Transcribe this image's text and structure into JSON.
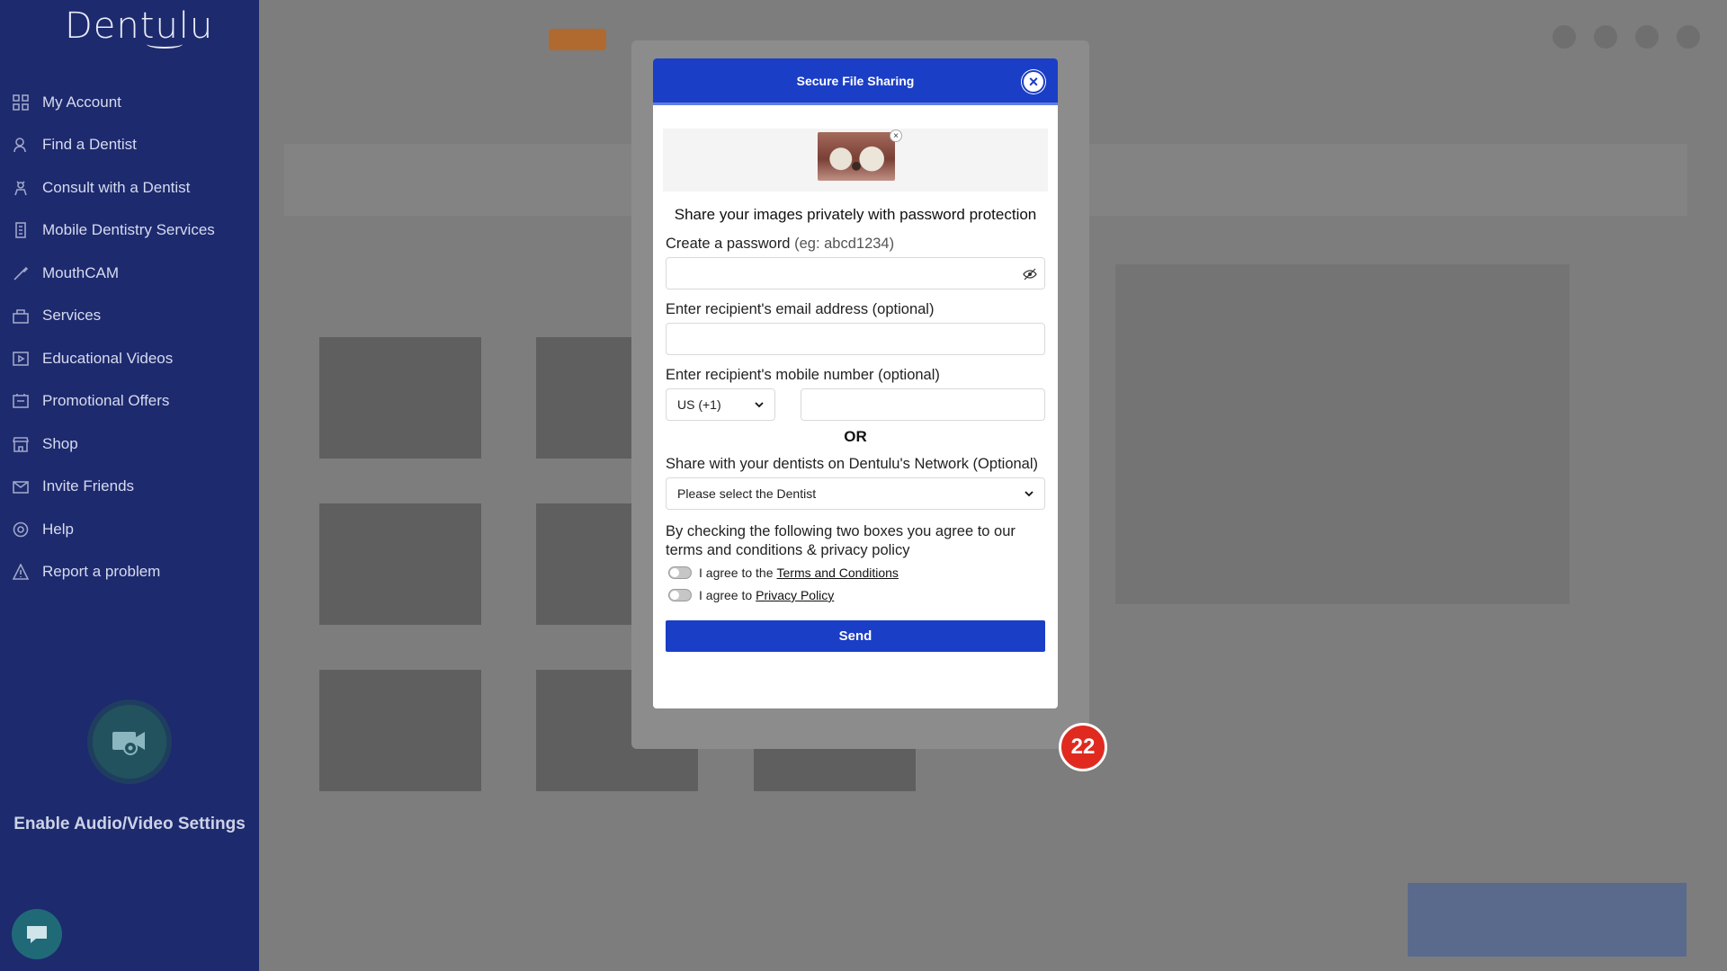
{
  "sidebar": {
    "logo": "Dentulu",
    "items": [
      {
        "label": "My Account",
        "icon": "grid-icon"
      },
      {
        "label": "Find a Dentist",
        "icon": "user-search-icon"
      },
      {
        "label": "Consult with a Dentist",
        "icon": "consult-icon"
      },
      {
        "label": "Mobile Dentistry Services",
        "icon": "building-icon"
      },
      {
        "label": "MouthCAM",
        "icon": "camera-wand-icon"
      },
      {
        "label": "Services",
        "icon": "services-icon"
      },
      {
        "label": "Educational Videos",
        "icon": "video-icon"
      },
      {
        "label": "Promotional Offers",
        "icon": "tag-icon"
      },
      {
        "label": "Shop",
        "icon": "shop-icon"
      },
      {
        "label": "Invite Friends",
        "icon": "invite-icon"
      },
      {
        "label": "Help",
        "icon": "help-icon"
      },
      {
        "label": "Report a problem",
        "icon": "warning-icon"
      }
    ],
    "av_settings_label": "Enable Audio/Video Settings"
  },
  "modal": {
    "title": "Secure File Sharing",
    "share_heading": "Share your images privately with password protection",
    "password_label": "Create a password",
    "password_hint": "(eg: abcd1234)",
    "email_label": "Enter recipient's email address (optional)",
    "mobile_label": "Enter recipient's mobile number (optional)",
    "country_code": "US (+1)",
    "or_text": "OR",
    "network_label": "Share with your dentists on Dentulu's Network (Optional)",
    "dentist_placeholder": "Please select the Dentist",
    "agreement_text": "By checking the following two boxes you agree to our terms and conditions & privacy policy",
    "terms_prefix": "I agree to the",
    "terms_link": "Terms and Conditions",
    "privacy_prefix": "I agree to",
    "privacy_link": "Privacy Policy",
    "send_label": "Send"
  },
  "badge": "22",
  "colors": {
    "sidebar": "#1d2a6e",
    "primary": "#1a3ec6",
    "badge": "#e02a20"
  }
}
